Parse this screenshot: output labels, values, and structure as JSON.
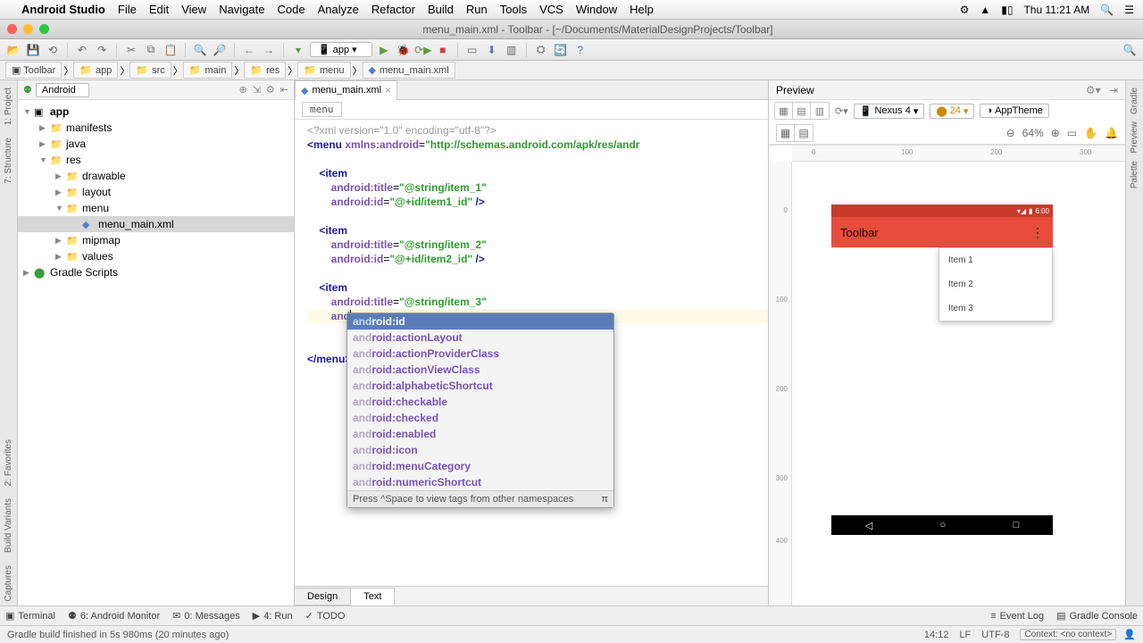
{
  "mac_menu": {
    "app": "Android Studio",
    "items": [
      "File",
      "Edit",
      "View",
      "Navigate",
      "Code",
      "Analyze",
      "Refactor",
      "Build",
      "Run",
      "Tools",
      "VCS",
      "Window",
      "Help"
    ],
    "clock": "Thu 11:21 AM"
  },
  "titlebar": "menu_main.xml - Toolbar - [~/Documents/MaterialDesignProjects/Toolbar]",
  "run_target": "app",
  "breadcrumb": [
    "Toolbar",
    "app",
    "src",
    "main",
    "res",
    "menu",
    "menu_main.xml"
  ],
  "project": {
    "selector": "Android",
    "tree": [
      {
        "d": 0,
        "kind": "mod",
        "label": "app",
        "exp": true,
        "bold": true
      },
      {
        "d": 1,
        "kind": "folder",
        "label": "manifests",
        "exp": false
      },
      {
        "d": 1,
        "kind": "folder",
        "label": "java",
        "exp": false
      },
      {
        "d": 1,
        "kind": "folder",
        "label": "res",
        "exp": true
      },
      {
        "d": 2,
        "kind": "folder",
        "label": "drawable",
        "exp": false
      },
      {
        "d": 2,
        "kind": "folder",
        "label": "layout",
        "exp": false
      },
      {
        "d": 2,
        "kind": "folder",
        "label": "menu",
        "exp": true
      },
      {
        "d": 3,
        "kind": "xml",
        "label": "menu_main.xml",
        "sel": true
      },
      {
        "d": 2,
        "kind": "folder",
        "label": "mipmap",
        "exp": false
      },
      {
        "d": 2,
        "kind": "folder",
        "label": "values",
        "exp": false
      },
      {
        "d": 0,
        "kind": "gradle",
        "label": "Gradle Scripts",
        "exp": false
      }
    ]
  },
  "editor": {
    "tab": "menu_main.xml",
    "crumb": "menu",
    "footer_tabs": [
      "Design",
      "Text"
    ],
    "lines": [
      {
        "t": "decl",
        "s": "<?xml version=\"1.0\" encoding=\"utf-8\"?>"
      },
      {
        "t": "open",
        "tag": "menu",
        "attrs": [
          {
            "n": "xmlns:android",
            "v": "http://schemas.android.com/apk/res/andr"
          }
        ],
        "truncated": true
      },
      {
        "t": "blank"
      },
      {
        "t": "itemopen",
        "indent": 1
      },
      {
        "t": "attr",
        "indent": 2,
        "n": "android:title",
        "v": "@string/item_1"
      },
      {
        "t": "attrclose",
        "indent": 2,
        "n": "android:id",
        "v": "@+id/item1_id"
      },
      {
        "t": "blank"
      },
      {
        "t": "itemopen",
        "indent": 1
      },
      {
        "t": "attr",
        "indent": 2,
        "n": "android:title",
        "v": "@string/item_2"
      },
      {
        "t": "attrclose",
        "indent": 2,
        "n": "android:id",
        "v": "@+id/item2_id"
      },
      {
        "t": "blank"
      },
      {
        "t": "itemopen",
        "indent": 1
      },
      {
        "t": "attr",
        "indent": 2,
        "n": "android:title",
        "v": "@string/item_3"
      },
      {
        "t": "typing",
        "indent": 2,
        "typed": "and"
      },
      {
        "t": "blank"
      },
      {
        "t": "blank"
      },
      {
        "t": "closemenu"
      }
    ]
  },
  "autocomplete": {
    "prefix": "and",
    "items": [
      "android:id",
      "android:actionLayout",
      "android:actionProviderClass",
      "android:actionViewClass",
      "android:alphabeticShortcut",
      "android:checkable",
      "android:checked",
      "android:enabled",
      "android:icon",
      "android:menuCategory",
      "android:numericShortcut"
    ],
    "selected": 0,
    "footer": "Press ^Space to view tags from other namespaces",
    "footer_icon": "π"
  },
  "preview": {
    "title": "Preview",
    "device": "Nexus 4",
    "api": "24",
    "theme": "AppTheme",
    "zoom": "64%",
    "ruler_h": [
      {
        "p": 22,
        "l": "0"
      },
      {
        "p": 122,
        "l": "100"
      },
      {
        "p": 222,
        "l": "200"
      },
      {
        "p": 322,
        "l": "300"
      }
    ],
    "ruler_v": [
      {
        "p": 50,
        "l": "0"
      },
      {
        "p": 150,
        "l": "100"
      },
      {
        "p": 250,
        "l": "200"
      },
      {
        "p": 350,
        "l": "300"
      },
      {
        "p": 420,
        "l": "400"
      }
    ],
    "clock": "6:00",
    "appbar_title": "Toolbar",
    "menu_items": [
      "Item 1",
      "Item 2",
      "Item 3"
    ]
  },
  "gutters": {
    "left_top": [
      "1: Project",
      "7: Structure"
    ],
    "left_bottom": [
      "2: Favorites",
      "Build Variants",
      "Captures"
    ],
    "right": [
      "Gradle",
      "Preview",
      "Palette"
    ]
  },
  "bottom": {
    "items": [
      "Terminal",
      "6: Android Monitor",
      "0: Messages",
      "4: Run",
      "TODO"
    ],
    "right_items": [
      "Event Log",
      "Gradle Console"
    ]
  },
  "status": {
    "msg": "Gradle build finished in 5s 980ms (20 minutes ago)",
    "pos": "14:12",
    "lf": "LF",
    "enc": "UTF-8",
    "ctx": "Context: <no context>"
  }
}
